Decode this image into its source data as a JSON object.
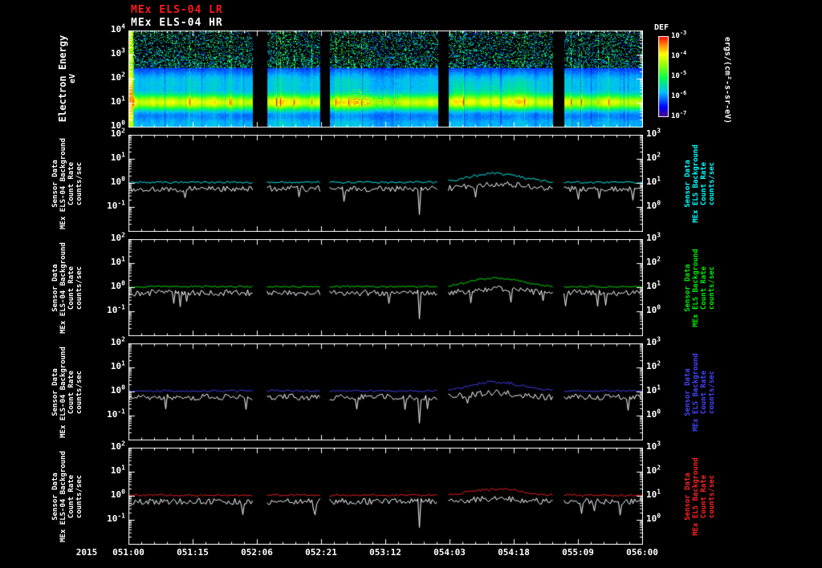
{
  "header": {
    "title_lr": "MEx ELS-04 LR",
    "title_hr": "MEx ELS-04 HR"
  },
  "colors": {
    "title_lr": "#ff1a1a",
    "title_hr": "#ffffff",
    "axis": "#ffffff",
    "background": "#000000",
    "trace_white": "#ffffff"
  },
  "spectrogram": {
    "y_axis_label_lines": [
      "Electron Energy",
      "eV"
    ],
    "y_ticks": {
      "base": "10",
      "exponents": [
        "4",
        "3",
        "2",
        "1",
        "0"
      ]
    },
    "colorbar": {
      "title": "DEF",
      "ticks": {
        "base": "10",
        "exponents": [
          "-3",
          "-4",
          "-5",
          "-6",
          "-7"
        ]
      },
      "units_label": "ergs/(cm²-s-sr-eV)"
    }
  },
  "line_panels": {
    "left_label_lines": [
      "Sensor Data",
      "MEx ELS-04 Background",
      "Count Rate",
      "counts/sec"
    ],
    "right_label_lines": [
      "Sensor Data",
      "MEx ELS Background",
      "Count Rate",
      "counts/sec"
    ],
    "left_ticks": {
      "base": "10",
      "exponents": [
        "2",
        "1",
        "0",
        "-1"
      ]
    },
    "right_ticks": {
      "base": "10",
      "exponents": [
        "3",
        "2",
        "1",
        "0"
      ]
    },
    "panels": [
      {
        "id": "count-rate-panel-1",
        "trace_color": "#00ffff"
      },
      {
        "id": "count-rate-panel-2",
        "trace_color": "#00ee00"
      },
      {
        "id": "count-rate-panel-3",
        "trace_color": "#4444ff"
      },
      {
        "id": "count-rate-panel-4",
        "trace_color": "#ff2222"
      }
    ]
  },
  "time_axis": {
    "year": "2015",
    "tick_labels": [
      "051:00",
      "051:15",
      "052:06",
      "052:21",
      "053:12",
      "054:03",
      "054:18",
      "055:09",
      "056:00"
    ]
  },
  "chart_data": {
    "type": [
      "heatmap",
      "line"
    ],
    "title": "MEx ELS-04 electron energy spectrogram with sensor and background count rates",
    "year": "2015",
    "time_tick_labels": [
      "051:00",
      "051:15",
      "052:06",
      "052:21",
      "053:12",
      "054:03",
      "054:18",
      "055:09",
      "056:00"
    ],
    "time_tick_spacing_hours": 15,
    "data_segments_fraction": [
      [
        0,
        0.242
      ],
      [
        0.269,
        0.372
      ],
      [
        0.391,
        0.602
      ],
      [
        0.622,
        0.825
      ],
      [
        0.847,
        1.0
      ]
    ],
    "spectrogram": {
      "ylabel": "Electron Energy (eV)",
      "y_range_eV": [
        1,
        10000
      ],
      "flux_label": "DEF",
      "flux_units": "ergs/(cm²-s-sr-eV)",
      "flux_range": [
        1e-07,
        0.001
      ],
      "photoelectron_band_eV": [
        8,
        25
      ],
      "diffuse_flux_eV": [
        30,
        300
      ],
      "noise_speckle_above_eV": 300,
      "bright_column_at_start": true,
      "red_patch_x_fraction": [
        0.43,
        0.53
      ]
    },
    "count_rate_panels": {
      "ylabel": "Count Rate (counts/sec)",
      "left_y_range": [
        0.01,
        100
      ],
      "right_y_range": [
        0.1,
        1000
      ],
      "background_level_counts_per_sec": 1.1,
      "sensor_level_counts_per_sec": 0.6,
      "enhancement_x_fraction": [
        0.63,
        0.8
      ],
      "enhancement_peak_factor": 2.5,
      "dropout_spike_x_fraction": 0.566
    },
    "render_seed": 20150051
  }
}
